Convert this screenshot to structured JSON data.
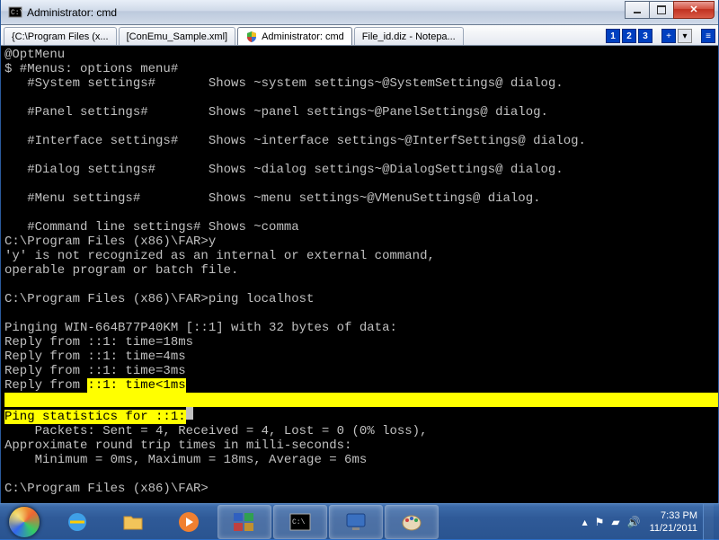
{
  "titlebar": {
    "title": "Administrator: cmd"
  },
  "tabs": [
    {
      "label": "{C:\\Program Files (x..."
    },
    {
      "label": "[ConEmu_Sample.xml]"
    },
    {
      "label": "Administrator: cmd",
      "active": true
    },
    {
      "label": "File_id.diz - Notepa..."
    }
  ],
  "tabbar": {
    "nums": [
      "1",
      "2",
      "3"
    ],
    "plus": "+",
    "down": "▾",
    "menu": "≡"
  },
  "terminal": {
    "lines": [
      "@OptMenu",
      "$ #Menus: options menu#",
      "   #System settings#       Shows ~system settings~@SystemSettings@ dialog.",
      "",
      "   #Panel settings#        Shows ~panel settings~@PanelSettings@ dialog.",
      "",
      "   #Interface settings#    Shows ~interface settings~@InterfSettings@ dialog.",
      "",
      "   #Dialog settings#       Shows ~dialog settings~@DialogSettings@ dialog.",
      "",
      "   #Menu settings#         Shows ~menu settings~@VMenuSettings@ dialog.",
      "",
      "   #Command line settings# Shows ~comma",
      "C:\\Program Files (x86)\\FAR>y",
      "'y' is not recognized as an internal or external command,",
      "operable program or batch file.",
      "",
      "C:\\Program Files (x86)\\FAR>ping localhost",
      "",
      "Pinging WIN-664B77P40KM [::1] with 32 bytes of data:",
      "Reply from ::1: time=18ms",
      "Reply from ::1: time=4ms",
      "Reply from ::1: time=3ms"
    ],
    "hl1_pre": "Reply from ",
    "hl1_sel": "::1: time<1ms",
    "hl2_full": "                                                                                                 ",
    "hl3_sel": "Ping statistics for ::1:",
    "stats1": "    Packets: Sent = 4, Received = 4, Lost = 0 (0% loss),",
    "stats2": "Approximate round trip times in milli-seconds:",
    "stats3": "    Minimum = 0ms, Maximum = 18ms, Average = 6ms",
    "prompt": "C:\\Program Files (x86)\\FAR>"
  },
  "tray": {
    "up": "▴",
    "net": "▰",
    "vol": "🔊",
    "time": "7:33 PM",
    "date": "11/21/2011"
  }
}
